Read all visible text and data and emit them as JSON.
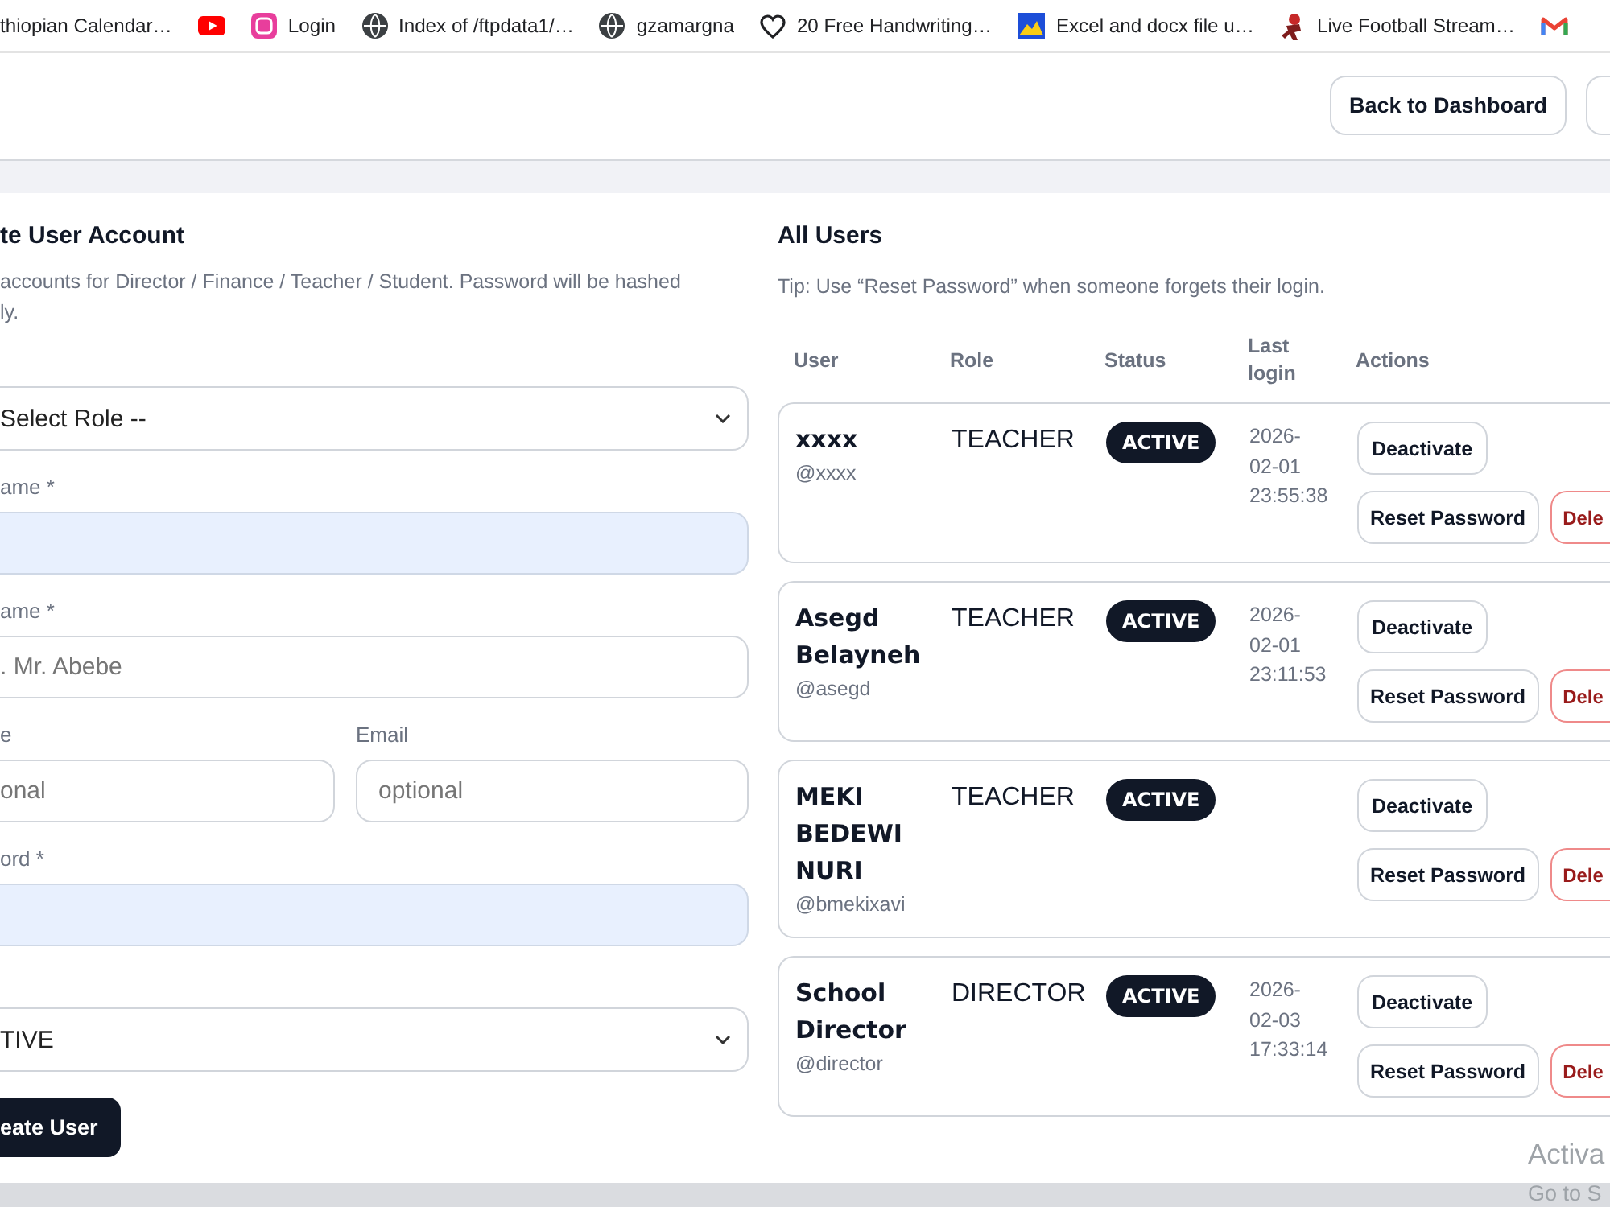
{
  "bookmarks": [
    {
      "kind": "text",
      "label": "thiopian Calendar…"
    },
    {
      "kind": "play"
    },
    {
      "kind": "badge",
      "label": "Login"
    },
    {
      "kind": "globe",
      "label": "Index of /ftpdata1/…"
    },
    {
      "kind": "globe",
      "label": "gzamargna"
    },
    {
      "kind": "heart",
      "label": "20 Free Handwriting…"
    },
    {
      "kind": "picture",
      "label": "Excel and docx file u…"
    },
    {
      "kind": "figure",
      "label": "Live Football Stream…"
    },
    {
      "kind": "mail"
    }
  ],
  "header": {
    "back_button": "Back to Dashboard"
  },
  "create_form": {
    "title": "te User Account",
    "description_lines": [
      "accounts for Director / Finance / Teacher / Student. Password will be hashed",
      "ly."
    ],
    "fields": [
      {
        "kind": "select",
        "value": "Select Role --"
      },
      {
        "kind": "input",
        "label": "ame *",
        "autofilled": true
      },
      {
        "kind": "input",
        "label": "ame *",
        "placeholder": ". Mr. Abebe",
        "autofilled": false
      },
      {
        "kind": "pair",
        "items": [
          {
            "label": "e",
            "placeholder": "onal"
          },
          {
            "label": "Email",
            "placeholder": "optional"
          }
        ]
      },
      {
        "kind": "input",
        "label": "ord *",
        "autofilled": true
      },
      {
        "kind": "select",
        "value": "TIVE"
      }
    ],
    "submit_button": "eate User"
  },
  "users_panel": {
    "title": "All Users",
    "tip": "Tip: Use “Reset Password” when someone forgets their login.",
    "columns": [
      "User",
      "Role",
      "Status",
      "Last login",
      "Actions"
    ],
    "rows": [
      {
        "name": "xxxx",
        "username": "@xxxx",
        "role": "TEACHER",
        "status": "ACTIVE",
        "last_login": "2026-02-01 23:55:38",
        "actions": [
          {
            "kind": "toggle",
            "label": "Deactivate"
          },
          {
            "kind": "reset",
            "label": "Reset Password"
          },
          {
            "kind": "delete",
            "label": "Dele"
          }
        ]
      },
      {
        "name": "Asegd Belayneh",
        "username": "@asegd",
        "role": "TEACHER",
        "status": "ACTIVE",
        "last_login": "2026-02-01 23:11:53",
        "actions": [
          {
            "kind": "toggle",
            "label": "Deactivate"
          },
          {
            "kind": "reset",
            "label": "Reset Password"
          },
          {
            "kind": "delete",
            "label": "Dele"
          }
        ]
      },
      {
        "name": "MEKI BEDEWI NURI",
        "username": "@bmekixavi",
        "role": "TEACHER",
        "status": "ACTIVE",
        "actions": [
          {
            "kind": "toggle",
            "label": "Deactivate"
          },
          {
            "kind": "reset",
            "label": "Reset Password"
          },
          {
            "kind": "delete",
            "label": "Dele"
          }
        ]
      },
      {
        "name": "School Director",
        "username": "@director",
        "role": "DIRECTOR",
        "status": "ACTIVE",
        "last_login": "2026-02-03 17:33:14",
        "actions": [
          {
            "kind": "toggle",
            "label": "Deactivate"
          },
          {
            "kind": "reset",
            "label": "Reset Password"
          },
          {
            "kind": "delete",
            "label": "Dele"
          }
        ]
      }
    ]
  },
  "os_watermark": [
    "Activa",
    "Go to S"
  ]
}
